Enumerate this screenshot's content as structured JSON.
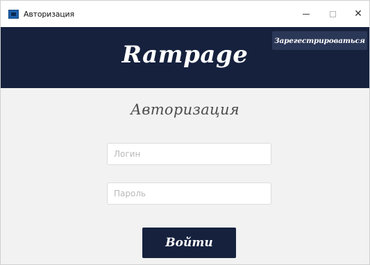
{
  "window": {
    "title": "Авторизация",
    "controls": {
      "minimize": "minimize",
      "maximize": "maximize",
      "close": "close"
    }
  },
  "header": {
    "brand": "Rampage",
    "register_label": "Зарегестрироваться",
    "background_color": "#16213e"
  },
  "form": {
    "title": "Авторизация",
    "login_placeholder": "Логин",
    "login_value": "",
    "password_placeholder": "Пароль",
    "password_value": "",
    "submit_label": "Войти"
  }
}
